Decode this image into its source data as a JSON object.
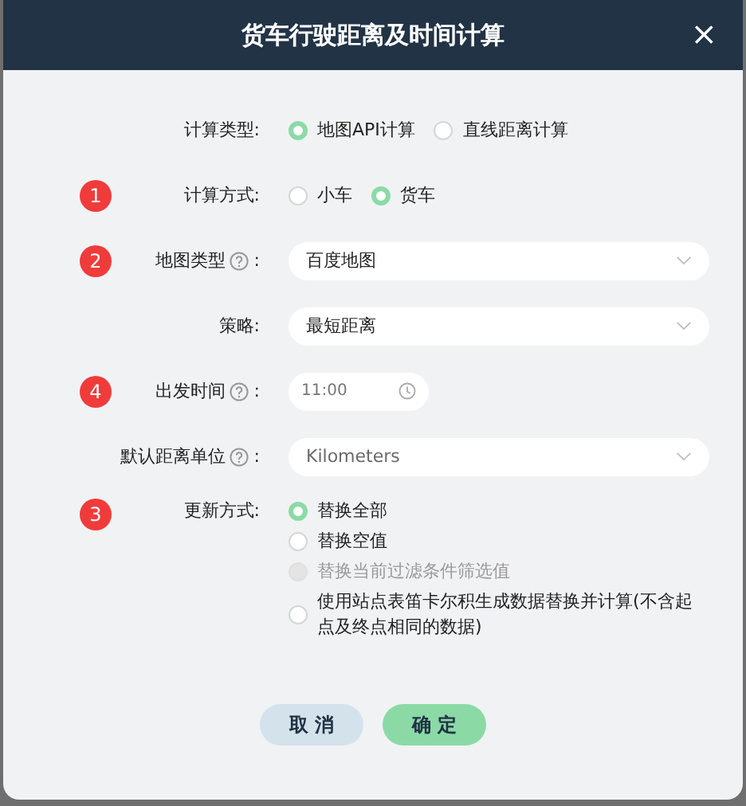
{
  "window": {
    "title": "货车行驶距离及时间计算",
    "close": "×"
  },
  "fields": [
    {
      "label": "计算类型:",
      "help": false,
      "kind": "radio",
      "options": [
        {
          "label": "地图API计算",
          "selected": true
        },
        {
          "label": "直线距离计算",
          "selected": false
        }
      ]
    },
    {
      "badge": "1",
      "label": "计算方式:",
      "help": false,
      "kind": "radio",
      "options": [
        {
          "label": "小车",
          "selected": false
        },
        {
          "label": "货车",
          "selected": true
        }
      ]
    },
    {
      "badge": "2",
      "label": "地图类型",
      "help": true,
      "colon": ":",
      "kind": "select",
      "value": "百度地图",
      "muted": false
    },
    {
      "label": "策略:",
      "help": false,
      "kind": "select",
      "value": "最短距离",
      "muted": false
    },
    {
      "badge": "4",
      "label": "出发时间",
      "help": true,
      "colon": ":",
      "kind": "time",
      "value": "11:00"
    },
    {
      "label": "默认距离单位",
      "help": true,
      "colon": ":",
      "kind": "select",
      "value": "Kilometers",
      "muted": true
    },
    {
      "badge": "3",
      "label": "更新方式:",
      "help": false,
      "kind": "radio-list",
      "options": [
        {
          "label": "替换全部",
          "selected": true,
          "disabled": false
        },
        {
          "label": "替换空值",
          "selected": false,
          "disabled": false
        },
        {
          "label": "替换当前过滤条件筛选值",
          "selected": false,
          "disabled": true
        },
        {
          "label": "使用站点表笛卡尔积生成数据替换并计算(不含起点及终点相同的数据)",
          "selected": false,
          "disabled": false
        }
      ]
    }
  ],
  "buttons": [
    {
      "label": "取 消",
      "kind": "cancel"
    },
    {
      "label": "确 定",
      "kind": "primary"
    }
  ]
}
